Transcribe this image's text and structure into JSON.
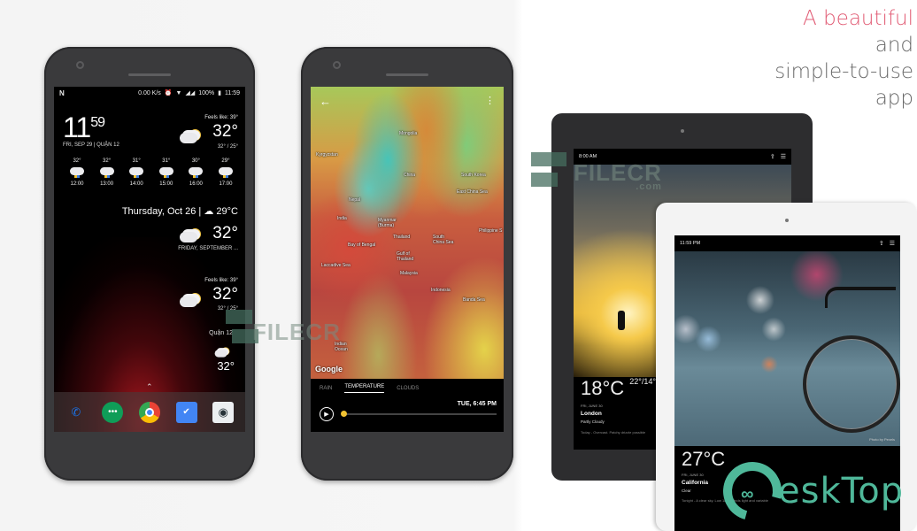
{
  "tagline": {
    "accent": "A beautiful",
    "rest": [
      "and",
      "simple-to-use",
      "app"
    ],
    "accent_color": "#e15b74"
  },
  "phone1": {
    "status": {
      "left_icon": "N",
      "speed": "0.00 K/s",
      "battery": "100%",
      "time": "11:59"
    },
    "clock": {
      "hour": "11",
      "minute": "59",
      "date": "FRI, SEP 29 | QUẬN 12"
    },
    "current": {
      "feels_like": "Feels like: 39°",
      "temp": "32°",
      "hilo": "32° / 25°"
    },
    "hourly": [
      {
        "temp": "32°",
        "time": "12:00"
      },
      {
        "temp": "32°",
        "time": "13:00"
      },
      {
        "temp": "31°",
        "time": "14:00"
      },
      {
        "temp": "31°",
        "time": "15:00"
      },
      {
        "temp": "30°",
        "time": "16:00"
      },
      {
        "temp": "29°",
        "time": "17:00"
      }
    ],
    "widget2": {
      "text": "Thursday, Oct 26 | ",
      "temp": "29°C"
    },
    "widget3": {
      "temp": "32°",
      "date": "FRIDAY, SEPTEMBER ..."
    },
    "widget4": {
      "feels_like": "Feels like: 39°",
      "temp": "32°",
      "hilo": "32° / 25°"
    },
    "widget5": {
      "location": "Quận 12",
      "temp": "32°"
    },
    "dock": [
      {
        "name": "phone-app",
        "glyph": "📞",
        "color": "#1a73e8"
      },
      {
        "name": "hangouts-app",
        "glyph": "…",
        "color": "#0f9d58"
      },
      {
        "name": "chrome-app",
        "glyph": "◉",
        "color": "#ea4335"
      },
      {
        "name": "inbox-app",
        "glyph": "✔",
        "color": "#4285f4"
      },
      {
        "name": "camera-app",
        "glyph": "◎",
        "color": "#e8eaed"
      }
    ]
  },
  "phone2": {
    "map_labels": [
      {
        "text": "Mongolia"
      },
      {
        "text": "Kyrgyzstan"
      },
      {
        "text": "China"
      },
      {
        "text": "South Korea"
      },
      {
        "text": "East China Sea"
      },
      {
        "text": "Nepal"
      },
      {
        "text": "India"
      },
      {
        "text": "Myanmar (Burma)"
      },
      {
        "text": "Bay of Bengal"
      },
      {
        "text": "Thailand"
      },
      {
        "text": "South China Sea"
      },
      {
        "text": "Gulf of Thailand"
      },
      {
        "text": "Laccadive Sea"
      },
      {
        "text": "Malaysia"
      },
      {
        "text": "Indonesia"
      },
      {
        "text": "Banda Sea"
      },
      {
        "text": "Indian Ocean"
      },
      {
        "text": "Philippine S"
      }
    ],
    "attribution": "Google",
    "tabs": [
      {
        "label": "RAIN",
        "active": false
      },
      {
        "label": "TEMPERATURE",
        "active": true
      },
      {
        "label": "CLOUDS",
        "active": false
      }
    ],
    "timestamp": "TUE, 6:45 PM",
    "timeline_progress": 0.0
  },
  "tablet1": {
    "time": "8:00 AM",
    "temp": "18°C",
    "hilo": "22°/14°",
    "date": "FRI, JUNE 30",
    "city": "London",
    "condition": "Partly Cloudy",
    "forecast": "Today - Overcast. Patchy drizzle possible"
  },
  "tablet2": {
    "time": "11:59 PM",
    "temp": "27°C",
    "date": "FRI, JUNE 30",
    "city": "California",
    "condition": "Clear",
    "forecast": "Tonight - A clear sky. Low 18C. Winds light and variable",
    "photo_credit": "Photo by Pexels"
  },
  "watermarks": {
    "filecr": "FILECR",
    "filecr_sub": ".com",
    "desktop": "eskTop"
  }
}
